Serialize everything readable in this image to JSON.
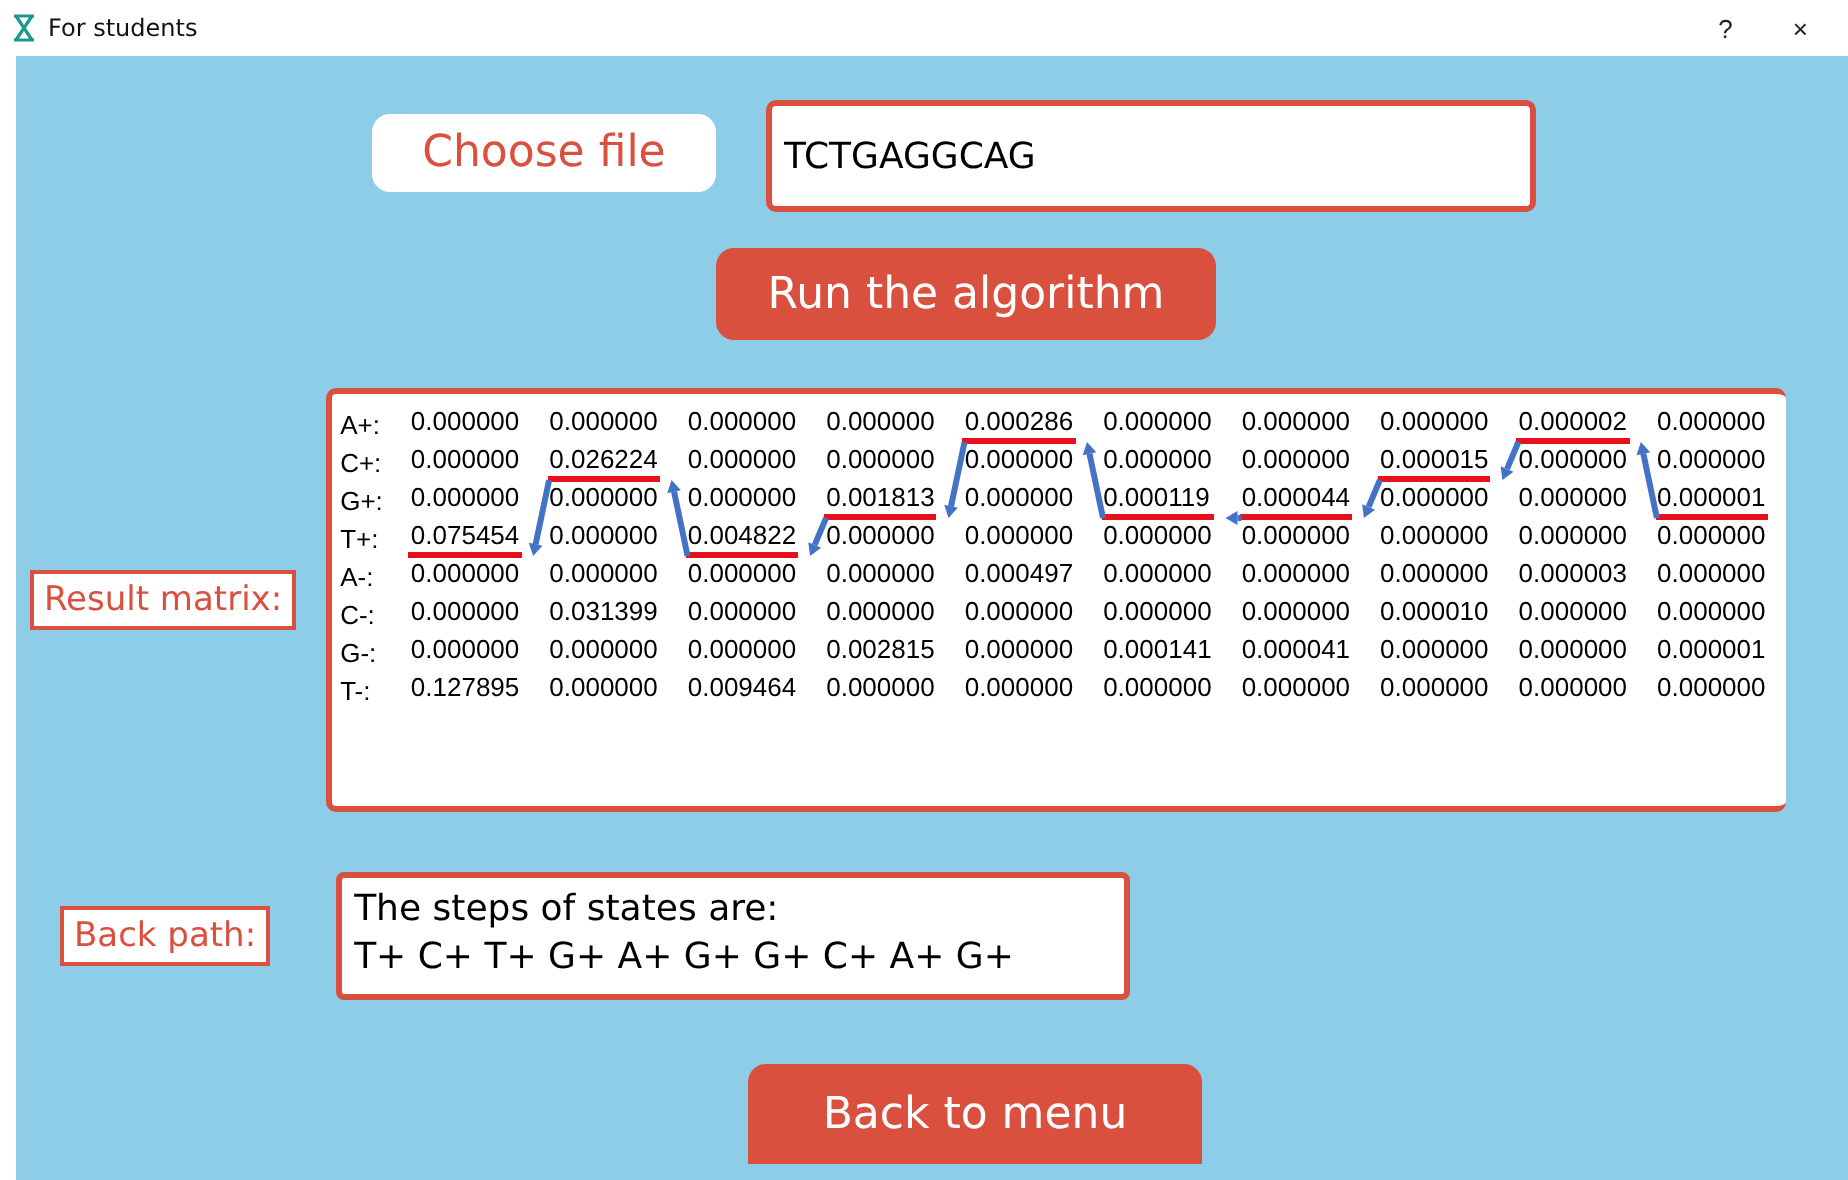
{
  "window": {
    "title": "For students",
    "help": "?",
    "close": "×"
  },
  "choose_file": {
    "label": "Choose file"
  },
  "sequence_field": {
    "value": "TCTGAGGCAG"
  },
  "run_button": {
    "label": "Run the algorithm"
  },
  "result_matrix": {
    "label": "Result matrix:",
    "rows": [
      {
        "label": "A+:",
        "cells": [
          {
            "value": "0.000000",
            "highlighted": false
          },
          {
            "value": "0.000000",
            "highlighted": false
          },
          {
            "value": "0.000000",
            "highlighted": false
          },
          {
            "value": "0.000000",
            "highlighted": false
          },
          {
            "value": "0.000286",
            "highlighted": true
          },
          {
            "value": "0.000000",
            "highlighted": false
          },
          {
            "value": "0.000000",
            "highlighted": false
          },
          {
            "value": "0.000000",
            "highlighted": false
          },
          {
            "value": "0.000002",
            "highlighted": true
          },
          {
            "value": "0.000000",
            "highlighted": false
          }
        ]
      },
      {
        "label": "C+:",
        "cells": [
          {
            "value": "0.000000",
            "highlighted": false
          },
          {
            "value": "0.026224",
            "highlighted": true
          },
          {
            "value": "0.000000",
            "highlighted": false
          },
          {
            "value": "0.000000",
            "highlighted": false
          },
          {
            "value": "0.000000",
            "highlighted": false
          },
          {
            "value": "0.000000",
            "highlighted": false
          },
          {
            "value": "0.000000",
            "highlighted": false
          },
          {
            "value": "0.000015",
            "highlighted": true
          },
          {
            "value": "0.000000",
            "highlighted": false
          },
          {
            "value": "0.000000",
            "highlighted": false
          }
        ]
      },
      {
        "label": "G+:",
        "cells": [
          {
            "value": "0.000000",
            "highlighted": false
          },
          {
            "value": "0.000000",
            "highlighted": false
          },
          {
            "value": "0.000000",
            "highlighted": false
          },
          {
            "value": "0.001813",
            "highlighted": true
          },
          {
            "value": "0.000000",
            "highlighted": false
          },
          {
            "value": "0.000119",
            "highlighted": true
          },
          {
            "value": "0.000044",
            "highlighted": true
          },
          {
            "value": "0.000000",
            "highlighted": false
          },
          {
            "value": "0.000000",
            "highlighted": false
          },
          {
            "value": "0.000001",
            "highlighted": true
          }
        ]
      },
      {
        "label": "T+:",
        "cells": [
          {
            "value": "0.075454",
            "highlighted": true
          },
          {
            "value": "0.000000",
            "highlighted": false
          },
          {
            "value": "0.004822",
            "highlighted": true
          },
          {
            "value": "0.000000",
            "highlighted": false
          },
          {
            "value": "0.000000",
            "highlighted": false
          },
          {
            "value": "0.000000",
            "highlighted": false
          },
          {
            "value": "0.000000",
            "highlighted": false
          },
          {
            "value": "0.000000",
            "highlighted": false
          },
          {
            "value": "0.000000",
            "highlighted": false
          },
          {
            "value": "0.000000",
            "highlighted": false
          }
        ]
      },
      {
        "label": "A-:",
        "cells": [
          {
            "value": "0.000000",
            "highlighted": false
          },
          {
            "value": "0.000000",
            "highlighted": false
          },
          {
            "value": "0.000000",
            "highlighted": false
          },
          {
            "value": "0.000000",
            "highlighted": false
          },
          {
            "value": "0.000497",
            "highlighted": false
          },
          {
            "value": "0.000000",
            "highlighted": false
          },
          {
            "value": "0.000000",
            "highlighted": false
          },
          {
            "value": "0.000000",
            "highlighted": false
          },
          {
            "value": "0.000003",
            "highlighted": false
          },
          {
            "value": "0.000000",
            "highlighted": false
          }
        ]
      },
      {
        "label": "C-:",
        "cells": [
          {
            "value": "0.000000",
            "highlighted": false
          },
          {
            "value": "0.031399",
            "highlighted": false
          },
          {
            "value": "0.000000",
            "highlighted": false
          },
          {
            "value": "0.000000",
            "highlighted": false
          },
          {
            "value": "0.000000",
            "highlighted": false
          },
          {
            "value": "0.000000",
            "highlighted": false
          },
          {
            "value": "0.000000",
            "highlighted": false
          },
          {
            "value": "0.000010",
            "highlighted": false
          },
          {
            "value": "0.000000",
            "highlighted": false
          },
          {
            "value": "0.000000",
            "highlighted": false
          }
        ]
      },
      {
        "label": "G-:",
        "cells": [
          {
            "value": "0.000000",
            "highlighted": false
          },
          {
            "value": "0.000000",
            "highlighted": false
          },
          {
            "value": "0.000000",
            "highlighted": false
          },
          {
            "value": "0.002815",
            "highlighted": false
          },
          {
            "value": "0.000000",
            "highlighted": false
          },
          {
            "value": "0.000141",
            "highlighted": false
          },
          {
            "value": "0.000041",
            "highlighted": false
          },
          {
            "value": "0.000000",
            "highlighted": false
          },
          {
            "value": "0.000000",
            "highlighted": false
          },
          {
            "value": "0.000001",
            "highlighted": false
          }
        ]
      },
      {
        "label": "T-:",
        "cells": [
          {
            "value": "0.127895",
            "highlighted": false
          },
          {
            "value": "0.000000",
            "highlighted": false
          },
          {
            "value": "0.009464",
            "highlighted": false
          },
          {
            "value": "0.000000",
            "highlighted": false
          },
          {
            "value": "0.000000",
            "highlighted": false
          },
          {
            "value": "0.000000",
            "highlighted": false
          },
          {
            "value": "0.000000",
            "highlighted": false
          },
          {
            "value": "0.000000",
            "highlighted": false
          },
          {
            "value": "0.000000",
            "highlighted": false
          },
          {
            "value": "0.000000",
            "highlighted": false
          }
        ]
      }
    ]
  },
  "back_path": {
    "label": "Back path:",
    "heading": "The steps of states are:",
    "path": "T+ C+ T+ G+ A+ G+ G+ C+ A+ G+"
  },
  "back_button": {
    "label": "Back to menu"
  }
}
